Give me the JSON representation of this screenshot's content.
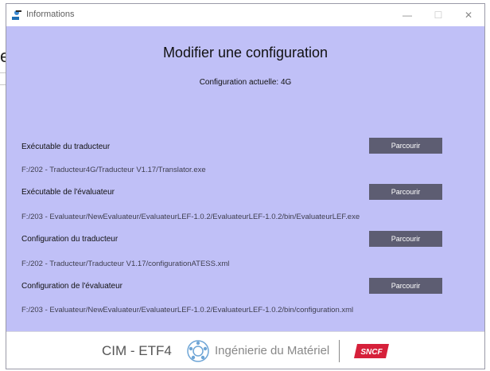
{
  "window": {
    "title": "Informations"
  },
  "page": {
    "title": "Modifier une configuration",
    "current_config": "Configuration actuelle: 4G"
  },
  "fields": [
    {
      "label": "Exécutable du traducteur",
      "path": "F:/202 - Traducteur4G/Traducteur V1.17/Translator.exe",
      "button": "Parcourir"
    },
    {
      "label": "Exécutable de l'évaluateur",
      "path": "F:/203 - Evaluateur/NewEvaluateur/EvaluateurLEF-1.0.2/EvaluateurLEF-1.0.2/bin/EvaluateurLEF.exe",
      "button": "Parcourir"
    },
    {
      "label": "Configuration du traducteur",
      "path": "F:/202 - Traducteur/Traducteur V1.17/configurationATESS.xml",
      "button": "Parcourir"
    },
    {
      "label": "Configuration de l'évaluateur",
      "path": "F:/203 - Evaluateur/NewEvaluateur/EvaluateurLEF-1.0.2/EvaluateurLEF-1.0.2/bin/configuration.xml",
      "button": "Parcourir"
    }
  ],
  "footer": {
    "cim": "CIM - ETF4",
    "ingenierie": "Ingénierie du Matériel",
    "sncf": "SNCF"
  },
  "colors": {
    "content_bg": "#c0c0f7",
    "button_bg": "#5d5d72",
    "sncf_red": "#d6203a"
  },
  "icons": {
    "title": "app-icon",
    "minimize": "minimize-icon",
    "maximize": "maximize-icon",
    "close": "close-icon",
    "footer_logo": "network-logo-icon"
  }
}
